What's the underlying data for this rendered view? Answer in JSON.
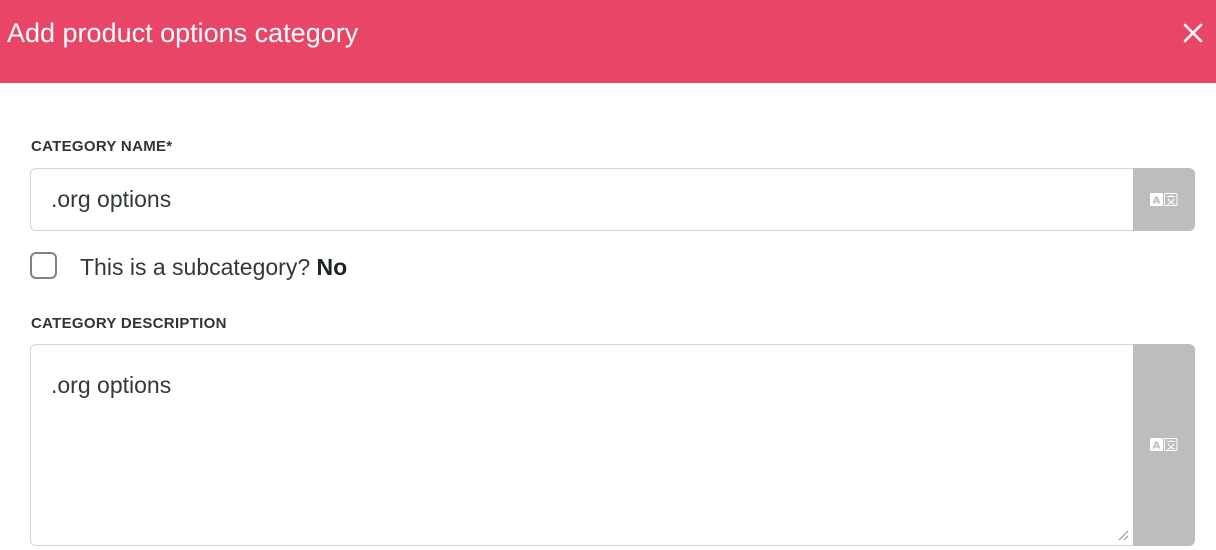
{
  "header": {
    "title": "Add product options category",
    "close_icon": "close-icon",
    "background_color": "#e84567"
  },
  "form": {
    "category_name": {
      "label": "CATEGORY NAME*",
      "value": ".org options",
      "translate_icon": "translate-icon"
    },
    "subcategory": {
      "label": "This is a subcategory?",
      "value": "No",
      "checked": false
    },
    "category_description": {
      "label": "CATEGORY DESCRIPTION",
      "value": ".org options",
      "translate_icon": "translate-icon"
    }
  }
}
